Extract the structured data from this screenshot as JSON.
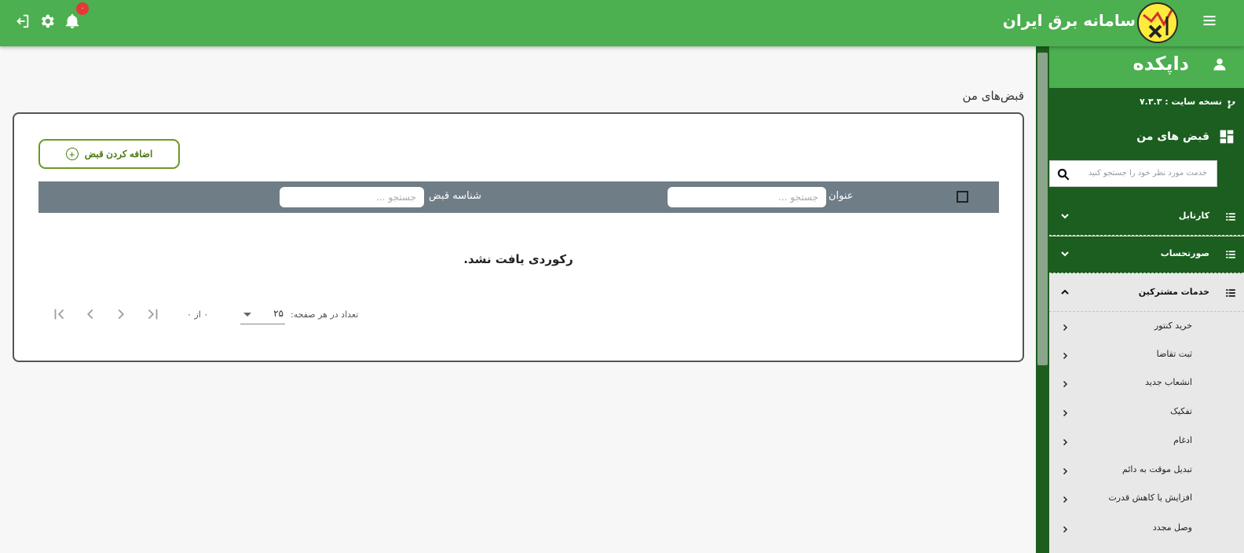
{
  "topbar": {
    "brand_title": "سامانه برق ایران",
    "notification_count": "۰",
    "icons": [
      "logout-icon",
      "gear-icon",
      "bell-icon",
      "menu-icon"
    ],
    "colors": {
      "bar": "#4caf50",
      "badge": "#e53935"
    }
  },
  "main": {
    "page_title": "قبض‌های من",
    "add_button_label": "اضافه کردن قبض",
    "table": {
      "col_title_label": "عنوان",
      "col_title_placeholder": "جستجو ...",
      "col_bill_id_label": "شناسه قبض",
      "col_bill_id_placeholder": "جستجو ..."
    },
    "empty_message": "رکوردی یافت نشد.",
    "pager": {
      "per_page_label": "تعداد در هر صفحه:",
      "per_page_value": "۲۵",
      "range_text": "۰ از ۰"
    }
  },
  "sidebar": {
    "user_name": "داپکده",
    "site_version": "نسخه سایت : ۷.۳.۳",
    "dashboard_label": "قبض های من",
    "search_placeholder": "خدمت مورد نظر خود را جستجو کنید",
    "groups": [
      {
        "label": "کارتابل"
      },
      {
        "label": "صورتحساب"
      }
    ],
    "open_group": {
      "label": "خدمات مشترکین",
      "items": [
        {
          "label": "خرید کنتور"
        },
        {
          "label": "ثبت تقاضا"
        },
        {
          "label": "انشعاب جدید"
        },
        {
          "label": "تفکیک"
        },
        {
          "label": "ادغام"
        },
        {
          "label": "تبدیل موقت به دائم"
        },
        {
          "label": "افزایش یا کاهش قدرت"
        },
        {
          "label": "وصل مجدد"
        }
      ]
    },
    "colors": {
      "dark": "#1b5e20",
      "light": "#4caf50"
    }
  }
}
